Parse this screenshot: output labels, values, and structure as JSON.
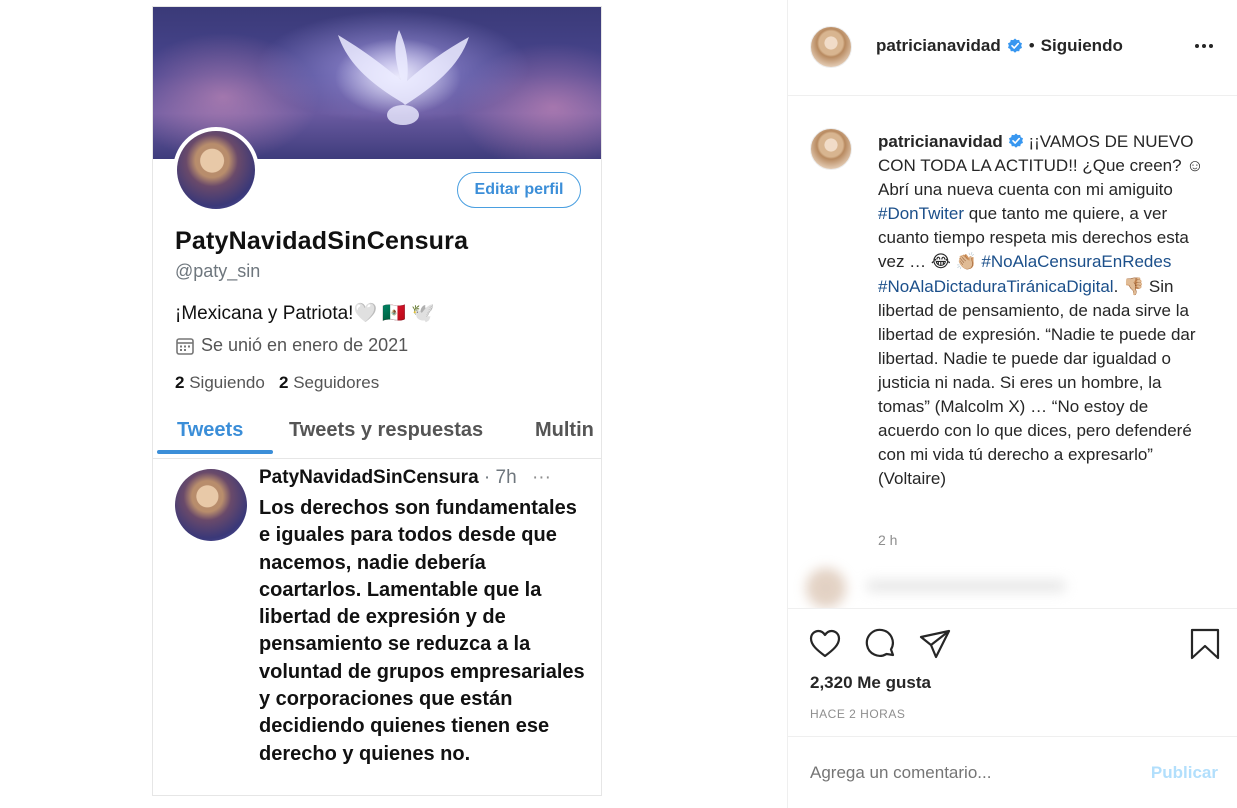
{
  "tweet_screenshot": {
    "edit_profile_label": "Editar perfil",
    "display_name": "PatyNavidadSinCensura",
    "handle": "@paty_sin",
    "bio": "¡Mexicana y Patriota!🤍 🇲🇽 🕊️",
    "joined": "Se unió en enero de 2021",
    "following_count": "2",
    "following_label": "Siguiendo",
    "followers_count": "2",
    "followers_label": "Seguidores",
    "tabs": [
      {
        "label": "Tweets"
      },
      {
        "label": "Tweets y respuestas"
      },
      {
        "label": "Multin"
      }
    ],
    "tweet": {
      "name": "PatyNavidadSinCensura",
      "time": "· 7h",
      "more": "···",
      "text": "Los derechos son fundamentales e iguales para todos desde que nacemos, nadie debería coartarlos. Lamentable que la libertad de expresión y de pensamiento se reduzca a la voluntad de grupos empresariales y corporaciones que están decidiendo quienes tienen ese derecho y quienes no."
    }
  },
  "post": {
    "header": {
      "username": "patricianavidad",
      "separator": "•",
      "following_label": "Siguiendo"
    },
    "caption": {
      "username": "patricianavidad",
      "text_1": " ¡¡VAMOS DE NUEVO CON TODA LA ACTITUD!! ¿Que creen? ☺ Abrí una nueva cuenta con mi amiguito ",
      "hashtag_1": "#DonTwiter",
      "text_2": " que tanto me quiere, a ver cuanto tiempo respeta mis derechos esta vez … 😂 👏🏼 ",
      "hashtag_2": "#NoAlaCensuraEnRedes",
      "hashtag_3": "#NoAlaDictaduraTiránicaDigital",
      "text_3": ". 👎🏼 Sin libertad de pensamiento, de nada sirve la libertad de expresión. “Nadie te puede dar libertad. Nadie te puede dar igualdad o justicia ni nada. Si eres un hombre, la tomas” (Malcolm X) … “No estoy de acuerdo con lo que dices, pero defenderé con mi vida tú derecho a expresarlo” (Voltaire)",
      "time": "2 h"
    },
    "likes": "2,320 Me gusta",
    "posted_ago": "HACE 2 HORAS",
    "comment": {
      "placeholder": "Agrega un comentario...",
      "publish_label": "Publicar"
    },
    "colors": {
      "link": "#1b4f8a",
      "verified": "#3897f0",
      "publish_disabled": "#b2dffc",
      "twitter_blue": "#3b8ed8"
    }
  }
}
